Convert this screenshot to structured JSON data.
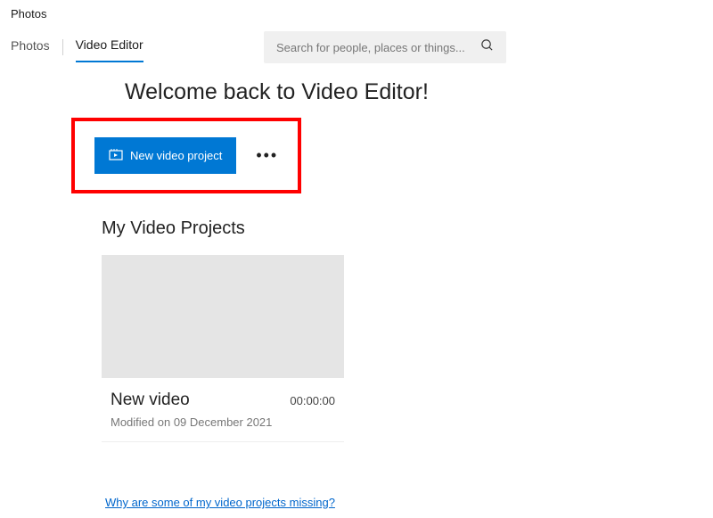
{
  "window": {
    "title": "Photos"
  },
  "tabs": {
    "photos": "Photos",
    "video_editor": "Video Editor"
  },
  "search": {
    "placeholder": "Search for people, places or things..."
  },
  "welcome": {
    "title": "Welcome back to Video Editor!"
  },
  "actions": {
    "new_project": "New video project"
  },
  "section": {
    "my_projects": "My Video Projects"
  },
  "project": {
    "name": "New video",
    "duration": "00:00:00",
    "modified": "Modified on 09 December 2021"
  },
  "link": {
    "missing": "Why are some of my video projects missing?"
  }
}
